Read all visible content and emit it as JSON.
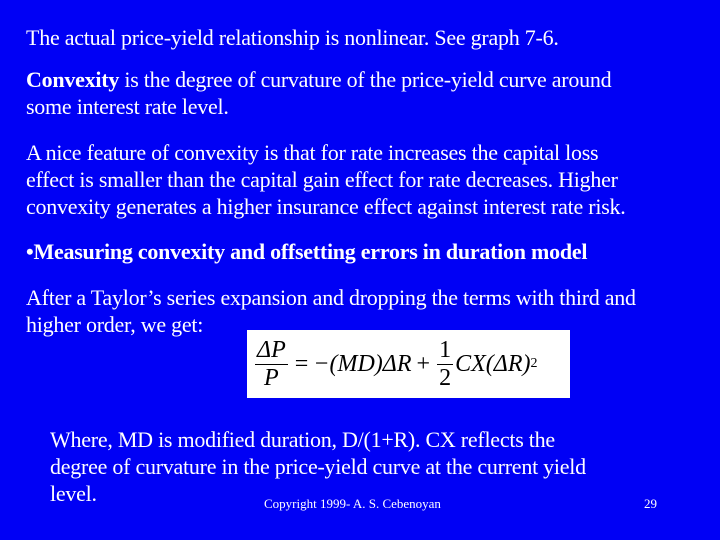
{
  "slide": {
    "background_color": "#0000f5",
    "text_color": "#ffffff",
    "paragraphs": {
      "p1": "The actual price-yield relationship is nonlinear.  See graph 7-6.",
      "p2_bold": "Convexity",
      "p2_line1_rest": " is the degree of curvature of the price-yield curve around",
      "p2_line2": "some interest rate level.",
      "p3_line1": "A nice feature of convexity is that for rate increases the capital loss",
      "p3_line2": "effect is smaller than the capital gain effect for rate decreases.   Higher",
      "p3_line3": "convexity generates a higher insurance effect against interest rate risk.",
      "p4_bullet": "•Measuring convexity and offsetting errors in duration model",
      "p5_line1": "After a Taylor’s series expansion and dropping the terms with third and",
      "p5_line2": "higher order, we get:",
      "p6_line1": "Where, MD is modified duration, D/(1+R).    CX reflects the",
      "p6_line2": "degree of curvature in the price-yield curve at the current yield",
      "p6_line3": "level."
    },
    "formula": {
      "lhs_numerator": "ΔP",
      "lhs_denominator": "P",
      "equals": "=",
      "term1": "−(MD)ΔR",
      "plus": "+",
      "half_numerator": "1",
      "half_denominator": "2",
      "term2": "CX(ΔR)",
      "exponent": "2"
    },
    "footer": {
      "copyright": "Copyright 1999- A. S. Cebenoyan",
      "page_number": "29"
    }
  }
}
